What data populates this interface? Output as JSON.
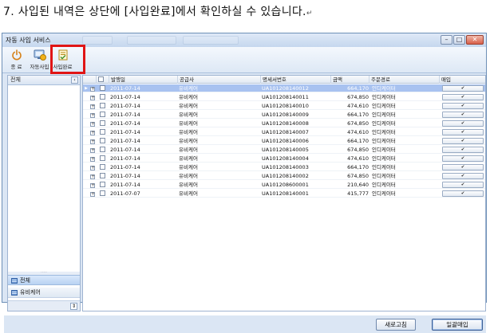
{
  "caption": {
    "text": "7. 사입된 내역은 상단에 [사입완료]에서 확인하실 수 있습니다.",
    "mark": "↵"
  },
  "window": {
    "title": "자동 사입 서비스",
    "ghost_tabs": [
      "",
      "",
      ""
    ],
    "controls": {
      "minimize": "–",
      "maximize": "□",
      "close": "✕"
    }
  },
  "toolbar": {
    "items": [
      {
        "label": "종 료",
        "icon": "power-icon"
      },
      {
        "label": "자동사입",
        "icon": "auto-purchase-icon"
      },
      {
        "label": "사입완료",
        "icon": "purchase-complete-icon"
      }
    ]
  },
  "left_panel": {
    "header": "전체",
    "collapse_glyph": "‹",
    "grip": "·····",
    "nav": [
      {
        "label": "전체",
        "icon": "grid-icon",
        "selected": true
      },
      {
        "label": "유비케어",
        "icon": "grid-icon",
        "selected": false
      }
    ],
    "scroll_glyph": "⇕"
  },
  "grid": {
    "columns": [
      "",
      "",
      "발행일",
      "공급사",
      "명세서번호",
      "금액",
      "주문경로",
      "매입"
    ],
    "rows": [
      {
        "date": "2011-07-14",
        "supplier": "유비케어",
        "invoice": "UA101208140012",
        "amount": "664,170",
        "route": "인디케이터",
        "action": "✔",
        "selected": true
      },
      {
        "date": "2011-07-14",
        "supplier": "유비케어",
        "invoice": "UA101208140011",
        "amount": "674,850",
        "route": "인디케이터",
        "action": "✔",
        "selected": false
      },
      {
        "date": "2011-07-14",
        "supplier": "유비케어",
        "invoice": "UA101208140010",
        "amount": "474,610",
        "route": "인디케이터",
        "action": "✔",
        "selected": false
      },
      {
        "date": "2011-07-14",
        "supplier": "유비케어",
        "invoice": "UA101208140009",
        "amount": "664,170",
        "route": "인디케이터",
        "action": "✔",
        "selected": false
      },
      {
        "date": "2011-07-14",
        "supplier": "유비케어",
        "invoice": "UA101208140008",
        "amount": "674,850",
        "route": "인디케이터",
        "action": "✔",
        "selected": false
      },
      {
        "date": "2011-07-14",
        "supplier": "유비케어",
        "invoice": "UA101208140007",
        "amount": "474,610",
        "route": "인디케이터",
        "action": "✔",
        "selected": false
      },
      {
        "date": "2011-07-14",
        "supplier": "유비케어",
        "invoice": "UA101208140006",
        "amount": "664,170",
        "route": "인디케이터",
        "action": "✔",
        "selected": false
      },
      {
        "date": "2011-07-14",
        "supplier": "유비케어",
        "invoice": "UA101208140005",
        "amount": "674,850",
        "route": "인디케이터",
        "action": "✔",
        "selected": false
      },
      {
        "date": "2011-07-14",
        "supplier": "유비케어",
        "invoice": "UA101208140004",
        "amount": "474,610",
        "route": "인디케이터",
        "action": "✔",
        "selected": false
      },
      {
        "date": "2011-07-14",
        "supplier": "유비케어",
        "invoice": "UA101208140003",
        "amount": "664,170",
        "route": "인디케이터",
        "action": "✔",
        "selected": false
      },
      {
        "date": "2011-07-14",
        "supplier": "유비케어",
        "invoice": "UA101208140002",
        "amount": "674,850",
        "route": "인디케이터",
        "action": "✔",
        "selected": false
      },
      {
        "date": "2011-07-14",
        "supplier": "유비케어",
        "invoice": "UA101208600001",
        "amount": "210,640",
        "route": "인디케이터",
        "action": "✔",
        "selected": false
      },
      {
        "date": "2011-07-07",
        "supplier": "유비케어",
        "invoice": "UA101208140001",
        "amount": "415,777",
        "route": "인디케이터",
        "action": "✔",
        "selected": false
      }
    ]
  },
  "footer": {
    "refresh_label": "새로고침",
    "bulk_label": "일괄매입"
  },
  "colors": {
    "highlight": "#e01515",
    "selected_row": "#a8c2f0",
    "window_frame": "#6d8fb6"
  }
}
